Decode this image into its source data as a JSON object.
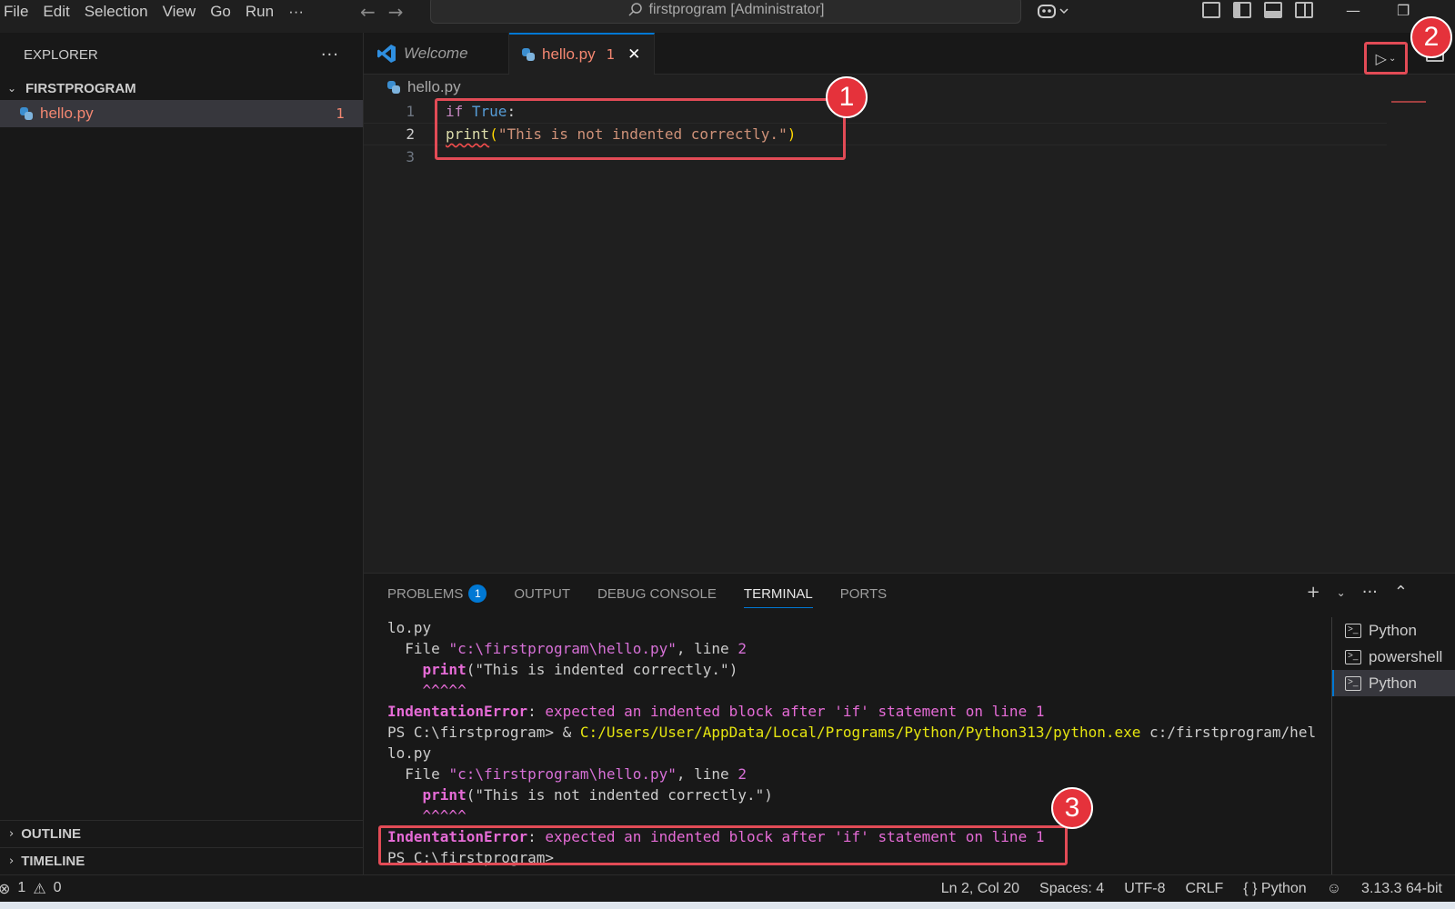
{
  "menu": [
    "File",
    "Edit",
    "Selection",
    "View",
    "Go",
    "Run",
    "···"
  ],
  "command_center": "firstprogram [Administrator]",
  "explorer": {
    "title": "EXPLORER",
    "folder": "FIRSTPROGRAM",
    "file": {
      "name": "hello.py",
      "problems": "1"
    },
    "outline": "OUTLINE",
    "timeline": "TIMELINE"
  },
  "tabs": {
    "welcome": "Welcome",
    "active": {
      "name": "hello.py",
      "problems": "1"
    }
  },
  "breadcrumb": "hello.py",
  "editor": {
    "line_numbers": [
      "1",
      "2",
      "3"
    ],
    "line1": {
      "kw": "if",
      "bool": "True",
      "rest": ":"
    },
    "line2": {
      "fn": "print",
      "open": "(",
      "str": "\"This is not indented correctly.\"",
      "close": ")"
    }
  },
  "panel": {
    "tabs": [
      "PROBLEMS",
      "OUTPUT",
      "DEBUG CONSOLE",
      "TERMINAL",
      "PORTS"
    ],
    "problems_count": "1",
    "terminal": {
      "l1": "lo.py",
      "l2": {
        "a": "  File ",
        "file": "\"c:\\firstprogram\\hello.py\"",
        "b": ", line ",
        "num": "2"
      },
      "l3": {
        "indent": "    ",
        "fn": "print",
        "rest": "(\"This is indented correctly.\")"
      },
      "l4": "    ^^^^^",
      "l5": {
        "err": "IndentationError",
        "colon": ": ",
        "msg": "expected an indented block after 'if' statement on line 1"
      },
      "l6": {
        "prompt": "PS C:\\firstprogram> & ",
        "path": "C:/Users/User/AppData/Local/Programs/Python/Python313/python.exe",
        "arg": " c:/firstprogram/hel"
      },
      "l7": "lo.py",
      "l8": {
        "a": "  File ",
        "file": "\"c:\\firstprogram\\hello.py\"",
        "b": ", line ",
        "num": "2"
      },
      "l9": {
        "indent": "    ",
        "fn": "print",
        "rest": "(\"This is not indented correctly.\")"
      },
      "l10": "    ^^^^^",
      "l11": {
        "err": "IndentationError",
        "colon": ": ",
        "msg": "expected an indented block after 'if' statement on line 1"
      },
      "l12": "PS C:\\firstprogram>"
    },
    "terminal_list": [
      "Python",
      "powershell",
      "Python"
    ]
  },
  "statusbar": {
    "errors": "1",
    "warnings": "0",
    "position": "Ln 2, Col 20",
    "spaces": "Spaces: 4",
    "encoding": "UTF-8",
    "eol": "CRLF",
    "language": "Python",
    "interpreter": "3.13.3 64-bit"
  },
  "annotations": [
    "1",
    "2",
    "3"
  ],
  "colors": {
    "accent": "#0078d4",
    "annotation": "#e24b56",
    "error": "#f48771"
  }
}
